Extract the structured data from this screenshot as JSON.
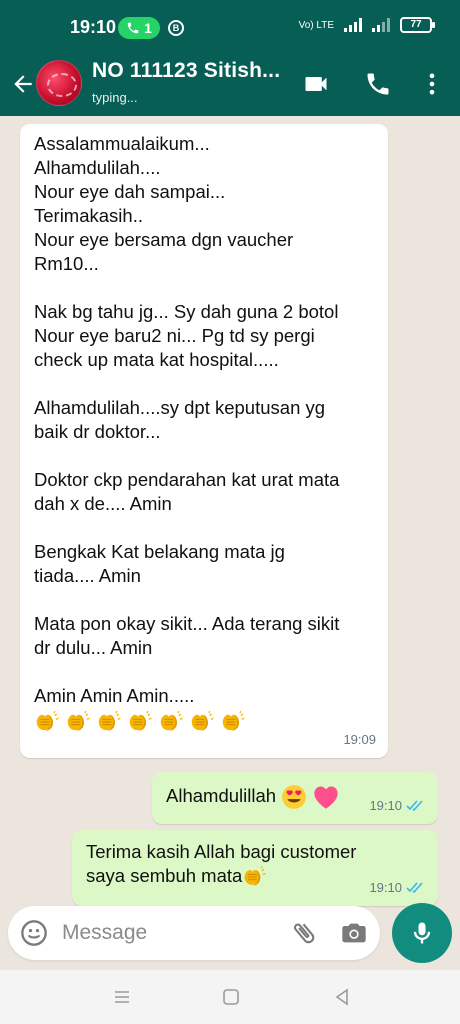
{
  "status_bar": {
    "time": "19:10",
    "call_count": "1",
    "circle_badge": "B",
    "net_label": "Vo) LTE",
    "battery": "77"
  },
  "header": {
    "contact_name": "NO 111123 Sitish...",
    "contact_status": "typing...",
    "icons": [
      "back-arrow-icon",
      "avatar",
      "video-call-icon",
      "phone-icon",
      "more-options-icon"
    ]
  },
  "messages": [
    {
      "direction": "incoming",
      "text": "Assalammualaikum...\nAlhamdulilah....\nNour eye dah sampai...\nTerimakasih..\nNour eye bersama dgn vaucher\nRm10...\n\nNak bg tahu jg... Sy dah guna 2 botol\nNour eye baru2 ni... Pg td sy pergi\ncheck up mata kat hospital.....\n\nAlhamdulilah....sy dpt keputusan yg\nbaik dr doktor...\n\nDoktor ckp pendarahan kat urat mata\ndah x de.... Amin\n\nBengkak Kat belakang mata jg\ntiada.... Amin\n\nMata pon okay sikit... Ada terang sikit\ndr dulu... Amin\n\nAmin Amin Amin.....",
      "emoji": [
        "clapping-hands",
        "clapping-hands",
        "clapping-hands",
        "clapping-hands",
        "clapping-hands",
        "clapping-hands",
        "clapping-hands"
      ],
      "time": "19:09"
    },
    {
      "direction": "outgoing",
      "text": "Alhamdulillah",
      "emoji": [
        "heart-eyes-face",
        "pink-heart"
      ],
      "time": "19:10",
      "status": "read"
    },
    {
      "direction": "outgoing",
      "text": "Terima kasih Allah bagi customer\nsaya sembuh mata",
      "emoji": [
        "clapping-hands"
      ],
      "time": "19:10",
      "status": "read"
    }
  ],
  "composer": {
    "placeholder": "Message",
    "icons": [
      "emoji-icon",
      "attach-icon",
      "camera-icon",
      "mic-icon"
    ]
  },
  "nav": {
    "icons": [
      "menu-icon",
      "home-icon",
      "back-icon"
    ]
  },
  "colors": {
    "header": "#075e54",
    "chat_background": "#ece5dd",
    "incoming_bubble": "#ffffff",
    "outgoing_bubble": "#dcf8c6",
    "accent": "#128c7e",
    "read_ticks": "#34b7f1"
  }
}
